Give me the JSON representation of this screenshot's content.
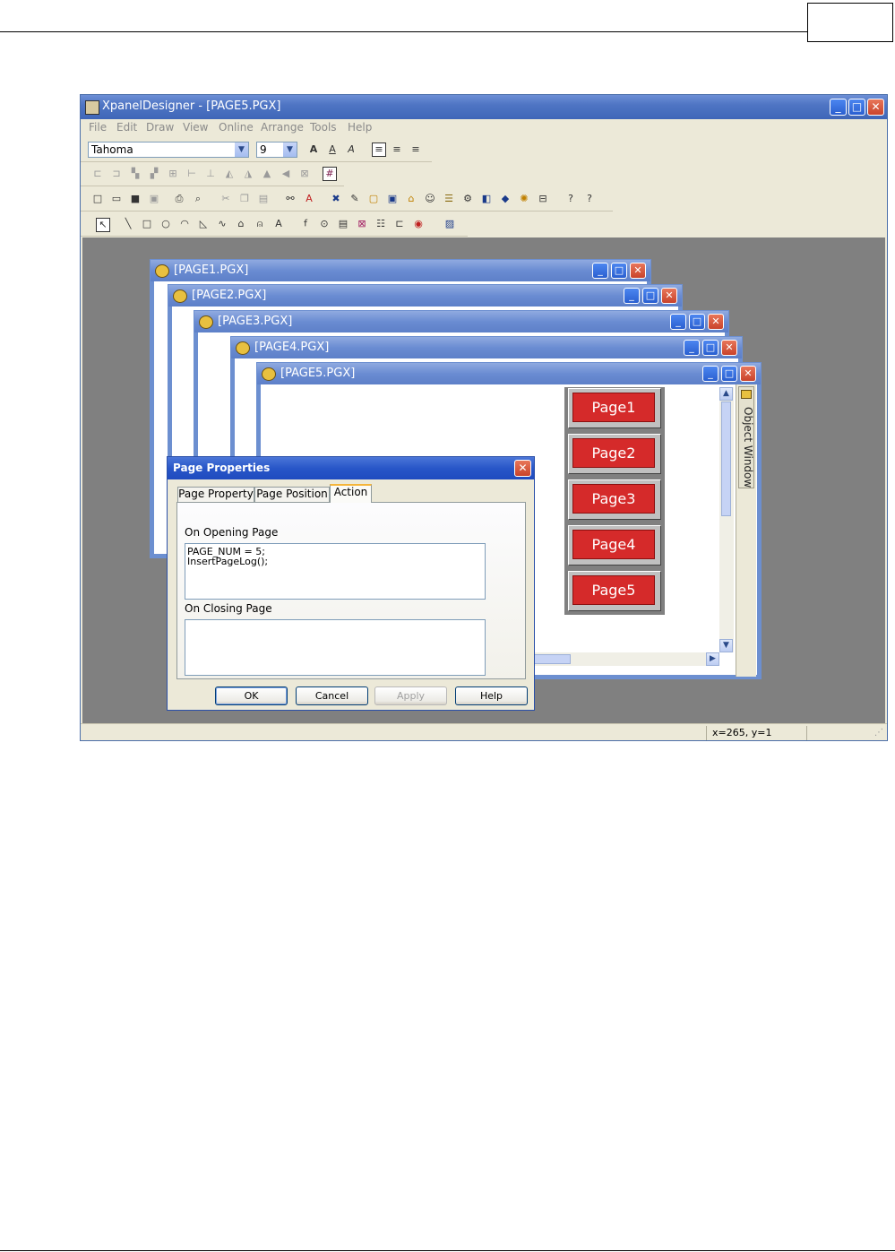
{
  "app": {
    "title": "XpanelDesigner - [PAGE5.PGX]"
  },
  "menu": [
    "File",
    "Edit",
    "Draw",
    "View",
    "Online",
    "Arrange",
    "Tools",
    "Help"
  ],
  "format_toolbar": {
    "font": "Tahoma",
    "size": "9"
  },
  "child_windows": [
    {
      "title": "[PAGE1.PGX]"
    },
    {
      "title": "[PAGE2.PGX]"
    },
    {
      "title": "[PAGE3.PGX]"
    },
    {
      "title": "[PAGE4.PGX]"
    },
    {
      "title": "[PAGE5.PGX]"
    }
  ],
  "page_buttons": [
    "Page1",
    "Page2",
    "Page3",
    "Page4",
    "Page5"
  ],
  "object_window": {
    "label": "Object Window"
  },
  "dialog": {
    "title": "Page Properties",
    "tabs": [
      "Page Property",
      "Page Position",
      "Action"
    ],
    "on_opening_label": "On Opening Page",
    "on_opening_code": "PAGE_NUM = 5;\nInsertPageLog();",
    "on_closing_label": "On Closing Page",
    "on_closing_code": "",
    "buttons": {
      "ok": "OK",
      "cancel": "Cancel",
      "apply": "Apply",
      "help": "Help"
    }
  },
  "status": {
    "coords": "x=265, y=1"
  }
}
